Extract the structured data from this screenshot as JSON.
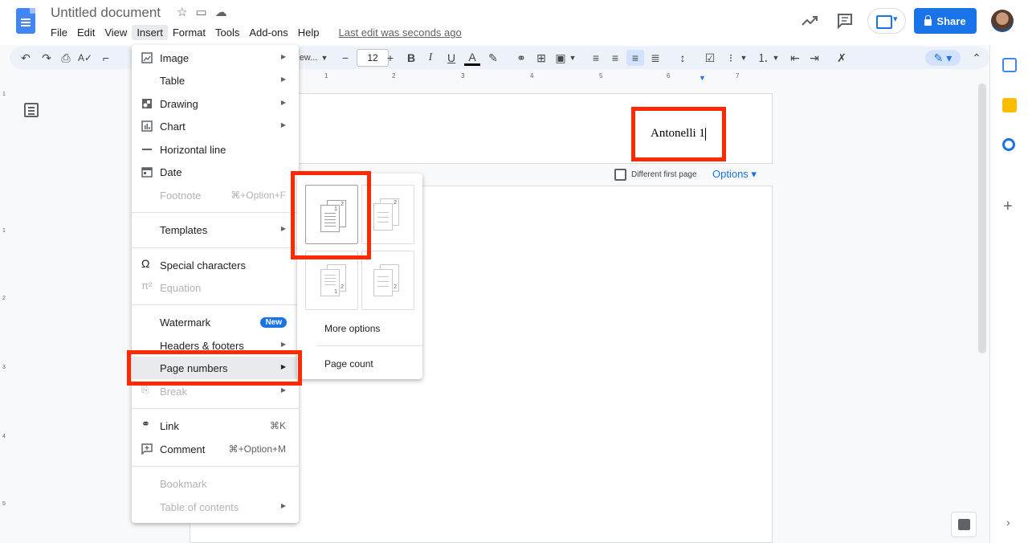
{
  "app": {
    "doc_title": "Untitled document",
    "menus": [
      "File",
      "Edit",
      "View",
      "Insert",
      "Format",
      "Tools",
      "Add-ons",
      "Help"
    ],
    "last_edit": "Last edit was seconds ago",
    "share_label": "Share"
  },
  "toolbar": {
    "font_name_fragment": "ew...",
    "font_size": "12",
    "minus": "−",
    "plus": "+"
  },
  "ruler": {
    "marks": [
      "1",
      "2",
      "3",
      "4",
      "5",
      "6",
      "7"
    ]
  },
  "vruler": {
    "marks": [
      "1",
      "1",
      "2",
      "3",
      "4",
      "5"
    ]
  },
  "page": {
    "header_text": "Antonelli 1",
    "different_first_page": "Different first page",
    "options_label": "Options ▾"
  },
  "insert_menu": {
    "items": [
      {
        "label": "Image",
        "arrow": "▶"
      },
      {
        "label": "Table",
        "arrow": "▶"
      },
      {
        "label": "Drawing",
        "arrow": "▶"
      },
      {
        "label": "Chart",
        "arrow": "▶"
      },
      {
        "label": "Horizontal line"
      },
      {
        "label": "Date"
      },
      {
        "label": "Footnote",
        "shortcut": "⌘+Option+F"
      },
      {
        "label": "Templates",
        "arrow": "▶"
      },
      {
        "label": "Special characters"
      },
      {
        "label": "Equation"
      },
      {
        "label": "Watermark",
        "badge": "New"
      },
      {
        "label": "Headers & footers",
        "arrow": "▶"
      },
      {
        "label": "Page numbers",
        "arrow": "▶"
      },
      {
        "label": "Break",
        "arrow": "▶"
      },
      {
        "label": "Link",
        "shortcut": "⌘K"
      },
      {
        "label": "Comment",
        "shortcut": "⌘+Option+M"
      },
      {
        "label": "Bookmark"
      },
      {
        "label": "Table of contents",
        "arrow": "▶"
      }
    ]
  },
  "page_numbers_submenu": {
    "more_options": "More options",
    "page_count": "Page count",
    "thumb_numbers": [
      "1",
      "2"
    ]
  },
  "colors": {
    "accent": "#1a73e8",
    "highlight": "#ff2a00"
  }
}
